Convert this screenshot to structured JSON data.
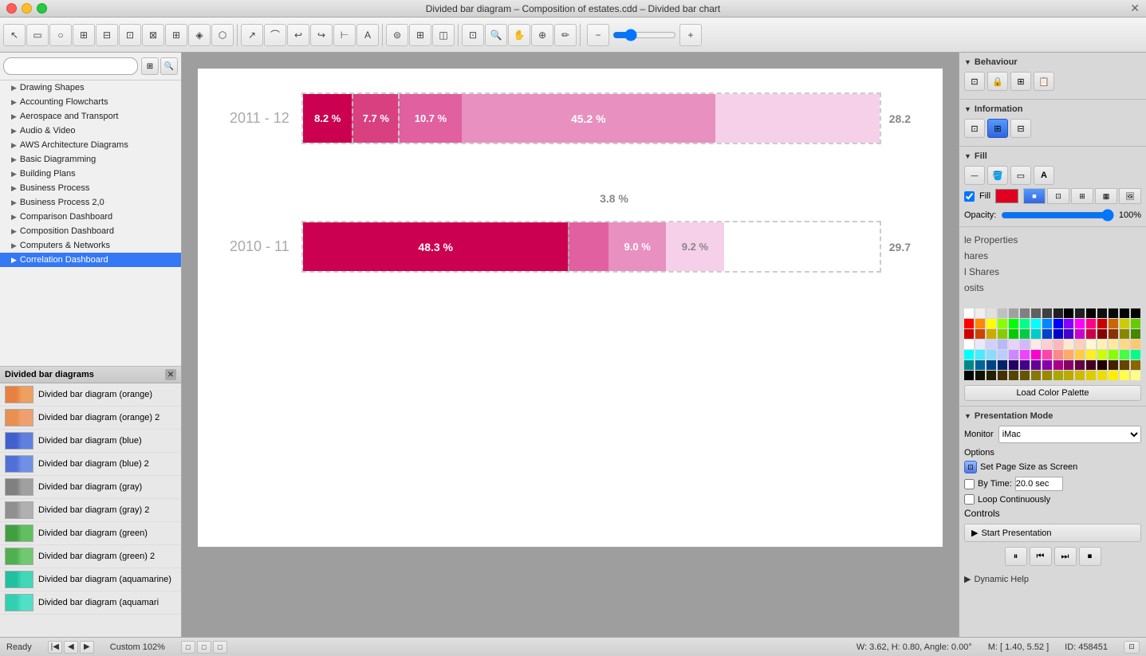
{
  "window": {
    "title": "Divided bar diagram – Composition of estates.cdd – Divided bar chart",
    "icon_text": "📊"
  },
  "toolbar": {
    "zoom_level": "Custom 102%",
    "zoom_value": "102"
  },
  "sidebar": {
    "search_placeholder": "",
    "items": [
      {
        "label": "Drawing Shapes",
        "has_arrow": true,
        "id": "drawing-shapes"
      },
      {
        "label": "Accounting Flowcharts",
        "has_arrow": true,
        "id": "accounting-flowcharts"
      },
      {
        "label": "Aerospace and Transport",
        "has_arrow": true,
        "id": "aerospace-transport"
      },
      {
        "label": "Audio & Video",
        "has_arrow": true,
        "id": "audio-video"
      },
      {
        "label": "AWS Architecture Diagrams",
        "has_arrow": true,
        "id": "aws-architecture"
      },
      {
        "label": "Basic Diagramming",
        "has_arrow": true,
        "id": "basic-diagramming"
      },
      {
        "label": "Building Plans",
        "has_arrow": true,
        "id": "building-plans"
      },
      {
        "label": "Business Process",
        "has_arrow": true,
        "id": "business-process"
      },
      {
        "label": "Business Process 2,0",
        "has_arrow": true,
        "id": "business-process-2"
      },
      {
        "label": "Comparison Dashboard",
        "has_arrow": true,
        "id": "comparison-dashboard"
      },
      {
        "label": "Composition Dashboard",
        "has_arrow": true,
        "id": "composition-dashboard"
      },
      {
        "label": "Computers & Networks",
        "has_arrow": true,
        "id": "computers-networks"
      },
      {
        "label": "Correlation Dashboard",
        "has_arrow": true,
        "id": "correlation-dashboard"
      }
    ]
  },
  "shapes_panel": {
    "title": "Divided bar diagrams",
    "items": [
      {
        "label": "Divided bar diagram (orange)",
        "color": "#e88040"
      },
      {
        "label": "Divided bar diagram (orange) 2",
        "color": "#e89050"
      },
      {
        "label": "Divided bar diagram (blue)",
        "color": "#4060d0"
      },
      {
        "label": "Divided bar diagram (blue) 2",
        "color": "#5070d8"
      },
      {
        "label": "Divided bar diagram (gray)",
        "color": "#808080"
      },
      {
        "label": "Divided bar diagram (gray) 2",
        "color": "#909090"
      },
      {
        "label": "Divided bar diagram (green)",
        "color": "#40a040"
      },
      {
        "label": "Divided bar diagram (green) 2",
        "color": "#50b050"
      },
      {
        "label": "Divided bar diagram (aquamarine)",
        "color": "#20c0a0"
      },
      {
        "label": "Divided bar diagram (aquamari",
        "color": "#30d0b0"
      }
    ]
  },
  "chart": {
    "row1": {
      "year": "2011 - 12",
      "segments": [
        {
          "pct": "8.2 %",
          "color": "#cc0050",
          "width_pct": 8.2
        },
        {
          "pct": "7.7 %",
          "color": "#d84080",
          "width_pct": 7.7
        },
        {
          "pct": "10.7 %",
          "color": "#e060a0",
          "width_pct": 10.7
        },
        {
          "pct": "45.2 %",
          "color": "#e890c0",
          "width_pct": 35
        },
        {
          "pct": "",
          "color": "#f0b8d8",
          "width_pct": 14
        }
      ],
      "overflow": "28.2",
      "float_label": "45.2 %"
    },
    "row2": {
      "year": "2010 - 11",
      "float_pct": "3.8 %",
      "segments": [
        {
          "pct": "48.3 %",
          "color": "#cc0050",
          "width_pct": 45
        },
        {
          "pct": "",
          "color": "#e060a0",
          "width_pct": 7
        },
        {
          "pct": "9.0 %",
          "color": "#e890c0",
          "width_pct": 10
        },
        {
          "pct": "9.2 %",
          "color": "#f0b8d8",
          "width_pct": 10
        }
      ],
      "overflow": "29.7"
    }
  },
  "right_panel": {
    "behaviour_section": {
      "title": "Behaviour"
    },
    "information_section": {
      "title": "Information"
    },
    "fill_section": {
      "title": "Fill",
      "fill_checked": true,
      "opacity_label": "Opacity:",
      "opacity_value": "100%",
      "fill_color": "#e00020",
      "style_btns": [
        "solid",
        "gradient-h",
        "gradient-v",
        "pattern",
        "image"
      ]
    },
    "properties_labels": [
      "le Properties",
      "hares",
      "l Shares",
      "osits"
    ],
    "colors": [
      "#ffffff",
      "#f0f0f0",
      "#e0e0e0",
      "#c0c0c0",
      "#a0a0a0",
      "#808080",
      "#606060",
      "#404040",
      "#202020",
      "#000000",
      "#202020",
      "#000000",
      "#101010",
      "#080808",
      "#040404",
      "#000000",
      "#ff0000",
      "#ff8800",
      "#ffff00",
      "#88ff00",
      "#00ff00",
      "#00ff88",
      "#00ffff",
      "#0088ff",
      "#0000ff",
      "#8800ff",
      "#ff00ff",
      "#ff0088",
      "#cc0000",
      "#cc6600",
      "#cccc00",
      "#66cc00",
      "#cc0000",
      "#cc4400",
      "#ccaa00",
      "#88cc00",
      "#00cc00",
      "#00cc44",
      "#00cccc",
      "#0044cc",
      "#0000cc",
      "#4400cc",
      "#cc00cc",
      "#cc0044",
      "#880000",
      "#883300",
      "#888800",
      "#448800",
      "#ffffff",
      "#e8e8ff",
      "#d0d0ff",
      "#b8b8ff",
      "#e8d0ff",
      "#d0b8ff",
      "#ffe8e8",
      "#ffd0d0",
      "#ffb8b8",
      "#ffe8d0",
      "#ffd0b8",
      "#fff8d0",
      "#fff0b8",
      "#ffe8a0",
      "#ffd888",
      "#ffc870",
      "#00ffff",
      "#44eeff",
      "#88ddff",
      "#bbccff",
      "#cc88ff",
      "#ee44ff",
      "#ff00cc",
      "#ff44aa",
      "#ff8888",
      "#ffaa66",
      "#ffcc44",
      "#ffee22",
      "#ccff00",
      "#88ff00",
      "#44ff44",
      "#00ff88",
      "#008888",
      "#006699",
      "#004488",
      "#002266",
      "#220066",
      "#440088",
      "#660099",
      "#8800aa",
      "#aa0088",
      "#880066",
      "#660044",
      "#440022",
      "#220000",
      "#442200",
      "#664400",
      "#886600",
      "#000000",
      "#111100",
      "#222200",
      "#443300",
      "#554400",
      "#665500",
      "#887700",
      "#998800",
      "#aaa900",
      "#bbaa00",
      "#ccbb00",
      "#ddcc00",
      "#eedd00",
      "#ffee00",
      "#ffff44",
      "#ffff88"
    ],
    "load_palette_label": "Load Color Palette",
    "presentation": {
      "title": "Presentation Mode",
      "monitor_label": "Monitor",
      "monitor_value": "iMac",
      "options_label": "Options",
      "set_page_size_label": "Set Page Size as Screen",
      "by_time_label": "By Time:",
      "by_time_value": "20.0 sec",
      "loop_label": "Loop Continuously",
      "controls_label": "Controls",
      "start_label": "Start Presentation"
    },
    "dynamic_help": "Dynamic Help"
  },
  "status_bar": {
    "ready": "Ready",
    "dimensions": "W: 3.62, H: 0.80, Angle: 0.00°",
    "zoom": "Custom 102%",
    "mouse": "M: [ 1.40, 5.52 ]",
    "id": "ID: 458451"
  }
}
